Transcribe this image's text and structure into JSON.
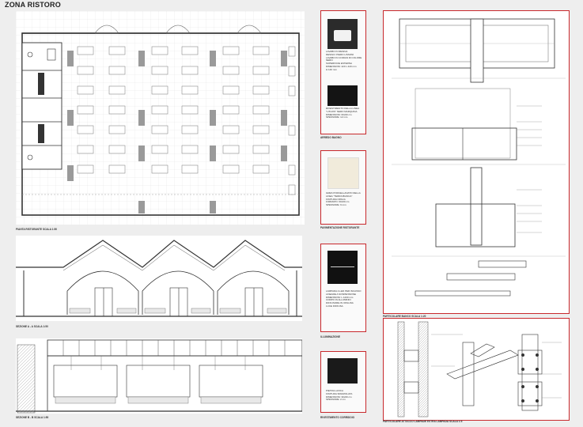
{
  "header": {
    "title": "ZONA RISTORO"
  },
  "drawings": {
    "plan_label": "PIANTA RISTORANTE    SCALA 1:50",
    "section_aa_label": "SEZIONE A - A    SCALA 1:50",
    "section_bb_label": "SEZIONE B - B    SCALA 1:50"
  },
  "materials": [
    {
      "category": "ARREDO BAGNO",
      "description": "LAVABO IN RESINA\nDESIGN: PIERO LISSONI\nLAVABO IN CORIAN DI COLORE NERO\nSUPERFICIE ESTERNA\nDIMENSIONI: 420 x 420 mm\nH 140 mm",
      "description2": "RIVESTIMENTO DELLA LINEA\n\"LITHOS\" NERO MARQUINA\nDIMENSIONI: 60x60 cm\nSPESSORE: 12 mm"
    },
    {
      "category": "PAVIMENTAZIONE RISTORANTE",
      "description": "GRES PORCELLANATO DELLA\nLINEA \"TERRA BIANCA\"\nFINITURA OPACA\nFORMATO: 60x60 cm\nSPESSORE: 9 mm"
    },
    {
      "category": "ILLUMINAZIONE",
      "description": "LAMPADA A LED PER INCASSO\nLINEARE A SOSPENSIONE\nDIMENSIONI: L 1200 mm\nCORPO IN ALLUMINIO\nDIFFUSORE IN OPALINA\nLUCE DIFFUSA"
    },
    {
      "category": "RIVESTIMENTO CORRIDOIO",
      "description": "PIETRA LAVICA\nFINITURA SPAZZOLATA\nDIMENSIONI: 30x60 cm\nSPESSORE: 2 cm"
    }
  ],
  "details": {
    "top_label": "PARTICOLARE BANCO",
    "top_sub": "SCALA 1:20",
    "bottom_label": "PARTICOLARE ATTACCO LAMPADE ESTRA LAMPADA",
    "bottom_sub": "SCALA 1:5"
  },
  "colors": {
    "accent": "#c8282c",
    "line": "#333333",
    "grid": "#d4d4d4"
  }
}
